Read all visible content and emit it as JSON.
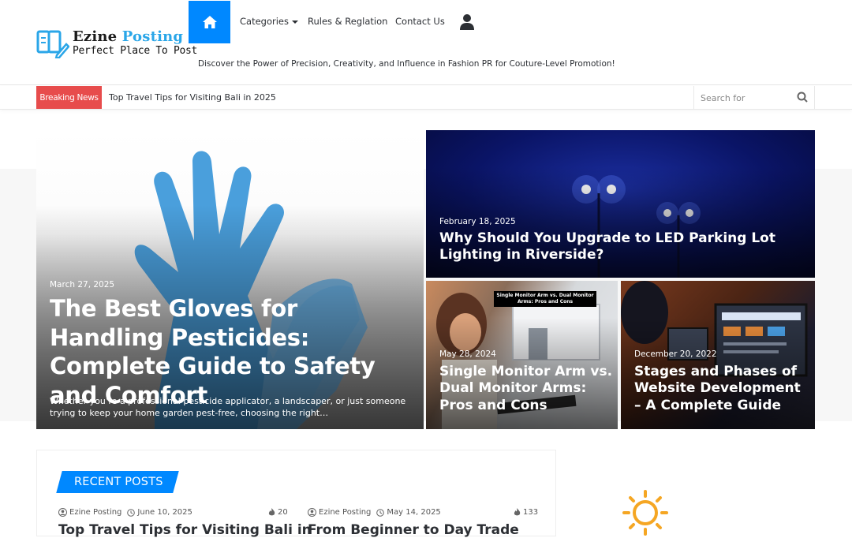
{
  "brand": {
    "name_dark": "Ezine ",
    "name_blue": "Posting",
    "slogan": "Perfect Place To Post"
  },
  "nav": {
    "items": [
      "Categories",
      "Rules & Reglation",
      "Contact Us"
    ],
    "tagline": "Discover the Power of Precision, Creativity, and Influence in Fashion PR for Couture-Level Promotion!"
  },
  "breaking": {
    "label": "Breaking News",
    "headline": "Top Travel Tips for Visiting Bali in 2025"
  },
  "search": {
    "placeholder": "Search for"
  },
  "slider": {
    "main": {
      "date": "March 27, 2025",
      "title": "The Best Gloves for Handling Pesticides: Complete Guide to Safety and Comfort",
      "excerpt": "Whether you’re a professional pesticide applicator, a landscaper, or just someone trying to keep your home garden pest-free, choosing the right…"
    },
    "led": {
      "date": "February 18, 2025",
      "title": "Why Should You Upgrade to LED Parking Lot Lighting in Riverside?"
    },
    "monitor": {
      "date": "May 28, 2024",
      "title": "Single Monitor Arm vs. Dual Monitor Arms: Pros and Cons",
      "image_caption": "Single Monitor Arm vs. Dual Monitor Arms: Pros and Cons"
    },
    "web": {
      "date": "December 20, 2022",
      "title": "Stages and Phases of Website Development – A Complete Guide"
    }
  },
  "recent": {
    "label": "RECENT POSTS",
    "posts": [
      {
        "author": "Ezine Posting",
        "date": "June 10, 2025",
        "views": "20",
        "title": "Top Travel Tips for Visiting Bali in"
      },
      {
        "author": "Ezine Posting",
        "date": "May 14, 2025",
        "views": "133",
        "title": "From Beginner to Day Trade"
      }
    ]
  },
  "colors": {
    "accent": "#0088ff",
    "breaking": "#e74c4c",
    "logo_blue": "#2aa6e8",
    "sun": "#f5a623"
  }
}
